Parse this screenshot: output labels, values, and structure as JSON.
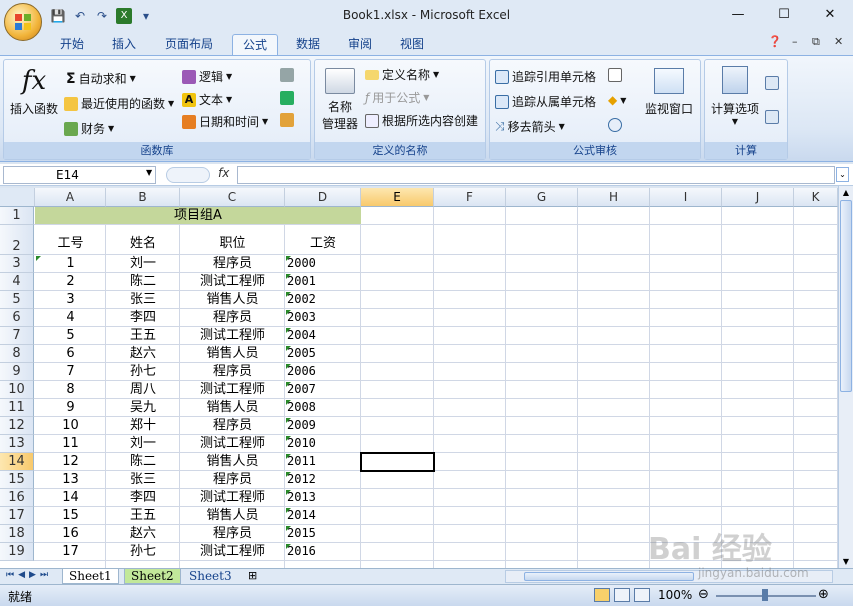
{
  "window": {
    "title": "Book1.xlsx - Microsoft Excel",
    "minimize": "—",
    "maximize": "☐",
    "close": "✕"
  },
  "tabs": [
    "开始",
    "插入",
    "页面布局",
    "公式",
    "数据",
    "审阅",
    "视图"
  ],
  "active_tab": "公式",
  "ribbon": {
    "function_library": {
      "label": "函数库",
      "insert_function": "插入函数",
      "autosum": "自动求和",
      "recent": "最近使用的函数",
      "financial": "财务",
      "logical": "逻辑",
      "text": "文本",
      "datetime": "日期和时间"
    },
    "defined_names": {
      "label": "定义的名称",
      "name_manager_1": "名称",
      "name_manager_2": "管理器",
      "define_name": "定义名称",
      "use_in_formula": "用于公式",
      "create_from_selection": "根据所选内容创建"
    },
    "formula_auditing": {
      "label": "公式审核",
      "trace_precedents": "追踪引用单元格",
      "trace_dependents": "追踪从属单元格",
      "remove_arrows": "移去箭头",
      "watch_window": "监视窗口"
    },
    "calculation": {
      "label": "计算",
      "calc_options": "计算选项"
    }
  },
  "formula_bar": {
    "name_box": "E14",
    "fx": "fx",
    "content": ""
  },
  "columns": [
    "A",
    "B",
    "C",
    "D",
    "E",
    "F",
    "G",
    "H",
    "I",
    "J",
    "K"
  ],
  "selected_column": "E",
  "selected_row": "14",
  "merged_title": "项目组A",
  "headers": {
    "a": "工号",
    "b": "姓名",
    "c": "职位",
    "d": "工资"
  },
  "rows": [
    {
      "r": "3",
      "id": "1",
      "name": "刘一",
      "role": "程序员",
      "salary": "2000"
    },
    {
      "r": "4",
      "id": "2",
      "name": "陈二",
      "role": "测试工程师",
      "salary": "2001"
    },
    {
      "r": "5",
      "id": "3",
      "name": "张三",
      "role": "销售人员",
      "salary": "2002"
    },
    {
      "r": "6",
      "id": "4",
      "name": "李四",
      "role": "程序员",
      "salary": "2003"
    },
    {
      "r": "7",
      "id": "5",
      "name": "王五",
      "role": "测试工程师",
      "salary": "2004"
    },
    {
      "r": "8",
      "id": "6",
      "name": "赵六",
      "role": "销售人员",
      "salary": "2005"
    },
    {
      "r": "9",
      "id": "7",
      "name": "孙七",
      "role": "程序员",
      "salary": "2006"
    },
    {
      "r": "10",
      "id": "8",
      "name": "周八",
      "role": "测试工程师",
      "salary": "2007"
    },
    {
      "r": "11",
      "id": "9",
      "name": "吴九",
      "role": "销售人员",
      "salary": "2008"
    },
    {
      "r": "12",
      "id": "10",
      "name": "郑十",
      "role": "程序员",
      "salary": "2009"
    },
    {
      "r": "13",
      "id": "11",
      "name": "刘一",
      "role": "测试工程师",
      "salary": "2010"
    },
    {
      "r": "14",
      "id": "12",
      "name": "陈二",
      "role": "销售人员",
      "salary": "2011"
    },
    {
      "r": "15",
      "id": "13",
      "name": "张三",
      "role": "程序员",
      "salary": "2012"
    },
    {
      "r": "16",
      "id": "14",
      "name": "李四",
      "role": "测试工程师",
      "salary": "2013"
    },
    {
      "r": "17",
      "id": "15",
      "name": "王五",
      "role": "销售人员",
      "salary": "2014"
    },
    {
      "r": "18",
      "id": "16",
      "name": "赵六",
      "role": "程序员",
      "salary": "2015"
    },
    {
      "r": "19",
      "id": "17",
      "name": "孙七",
      "role": "测试工程师",
      "salary": "2016"
    }
  ],
  "sheets": [
    "Sheet1",
    "Sheet2",
    "Sheet3"
  ],
  "status": {
    "ready": "就绪",
    "zoom": "100%"
  },
  "watermark": {
    "main": "Bai 经验",
    "sub": "jingyan.baidu.com"
  },
  "colors": {
    "merged_fill": "#c4d79b",
    "selected_header": "#f8c96c",
    "ribbon_text": "#15428b"
  }
}
